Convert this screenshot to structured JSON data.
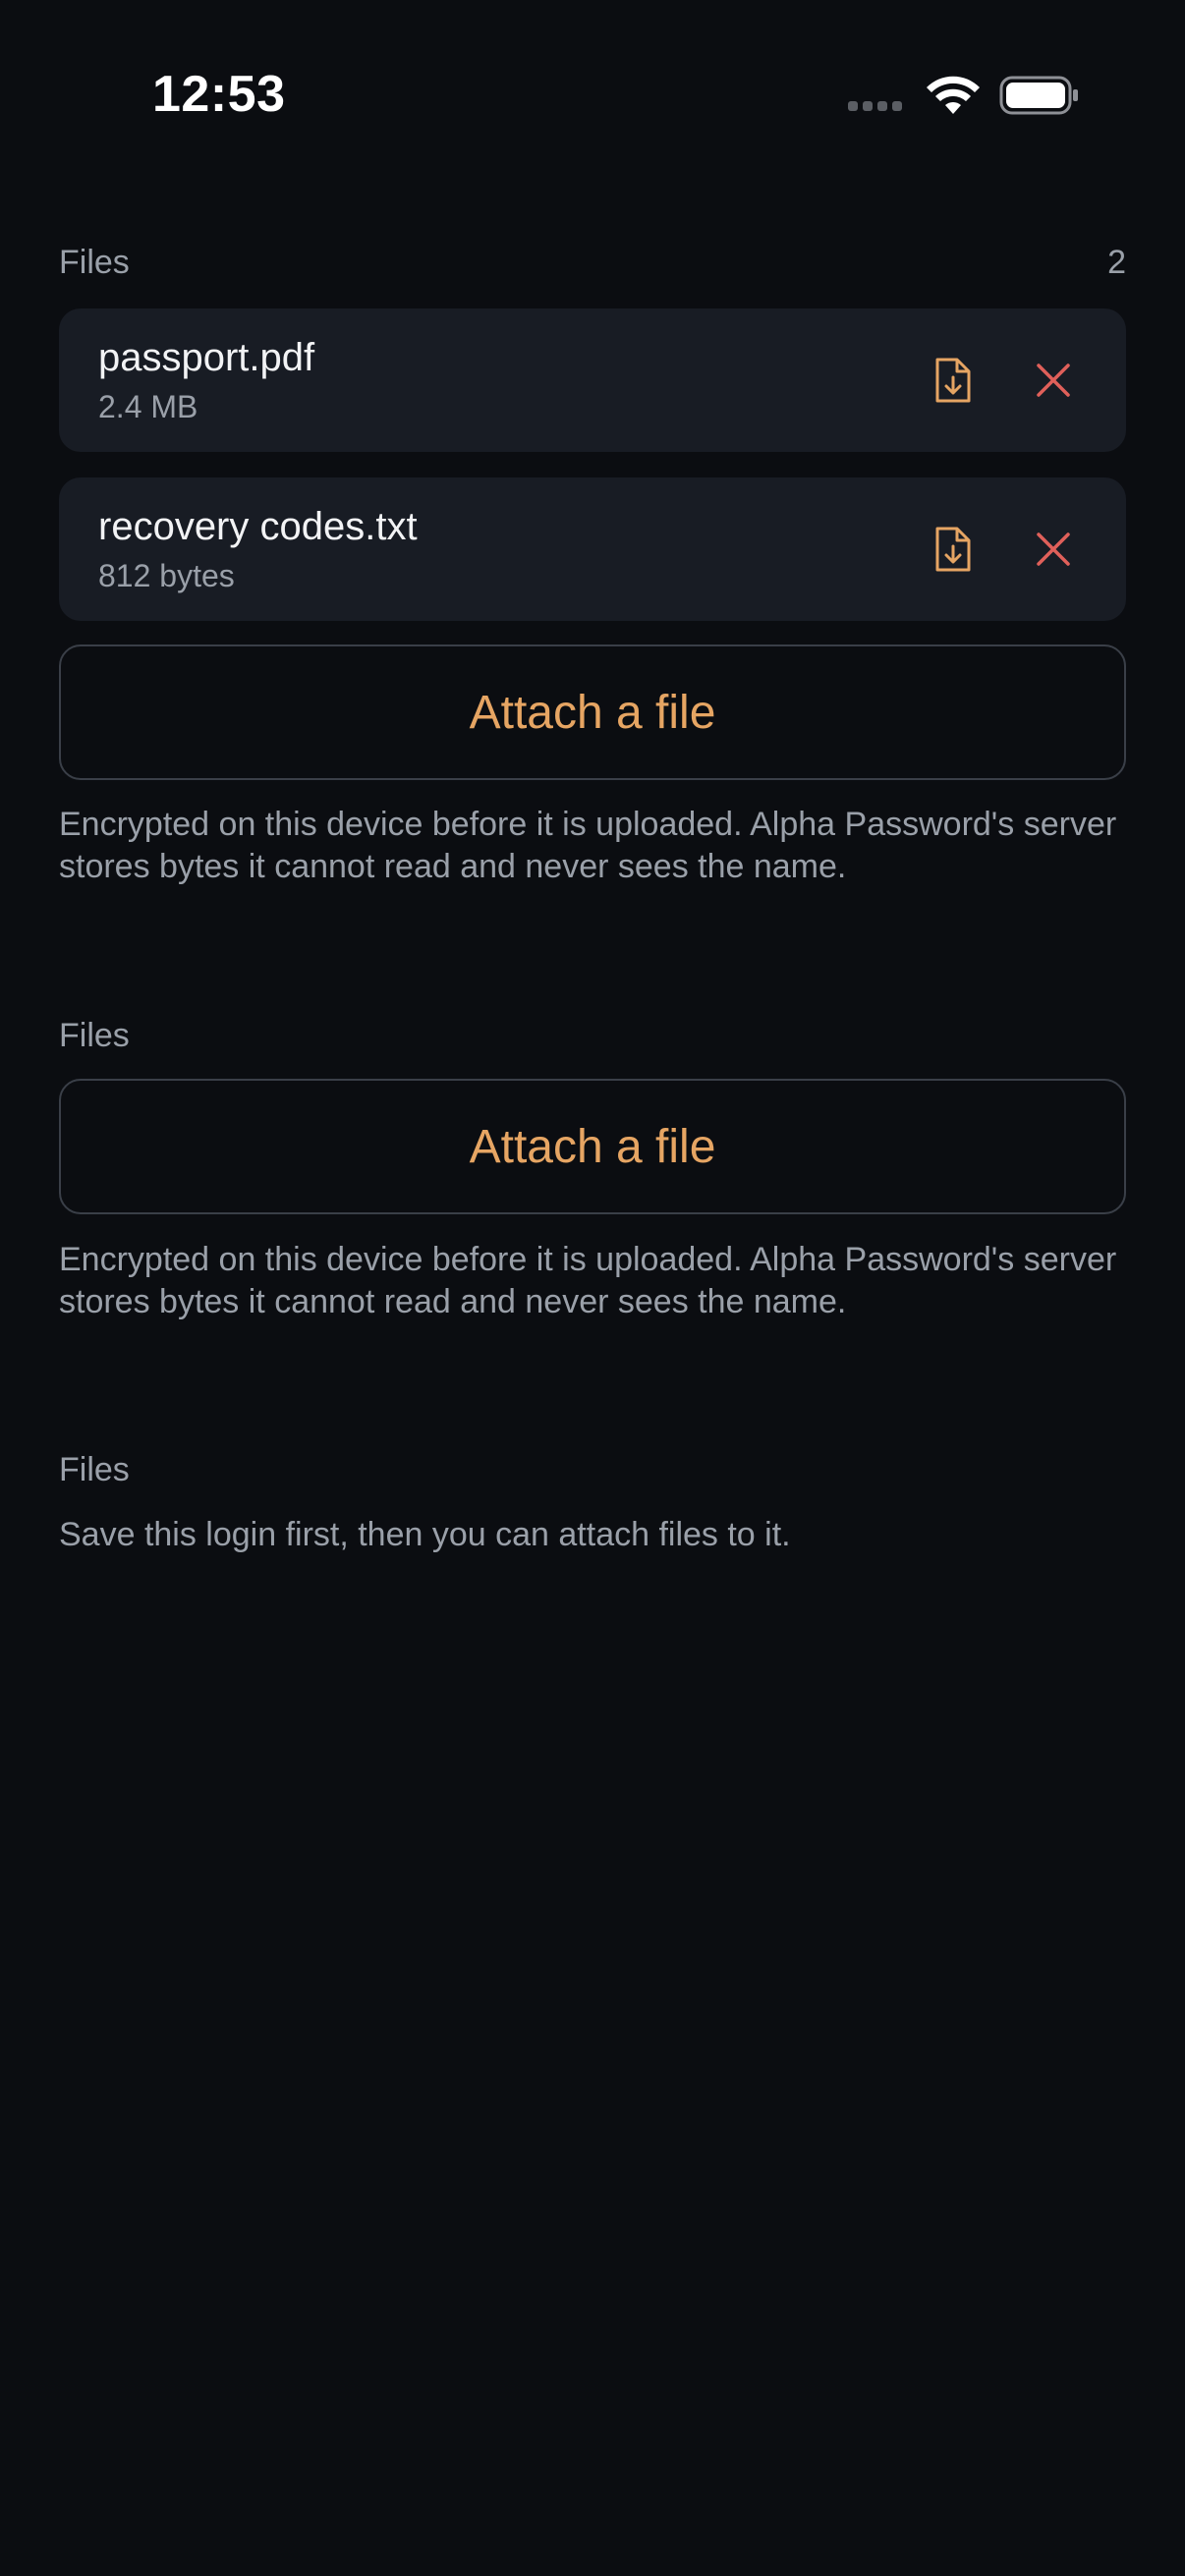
{
  "status_bar": {
    "time": "12:53"
  },
  "colors": {
    "background": "#0b0d11",
    "card": "#181c24",
    "accent": "#e6a563",
    "danger": "#e0605a",
    "muted_text": "#9aa0a9"
  },
  "section1": {
    "title": "Files",
    "count": "2",
    "files": [
      {
        "name": "passport.pdf",
        "size": "2.4 MB",
        "download_icon": "file-download-icon",
        "remove_icon": "close-icon"
      },
      {
        "name": "recovery codes.txt",
        "size": "812 bytes",
        "download_icon": "file-download-icon",
        "remove_icon": "close-icon"
      }
    ],
    "attach_label": "Attach a file",
    "helper": "Encrypted on this device before it is uploaded. Alpha Password's server stores bytes it cannot read and never sees the name."
  },
  "section2": {
    "title": "Files",
    "attach_label": "Attach a file",
    "helper": "Encrypted on this device before it is uploaded. Alpha Password's server stores bytes it cannot read and never sees the name."
  },
  "section3": {
    "title": "Files",
    "helper": "Save this login first, then you can attach files to it."
  }
}
